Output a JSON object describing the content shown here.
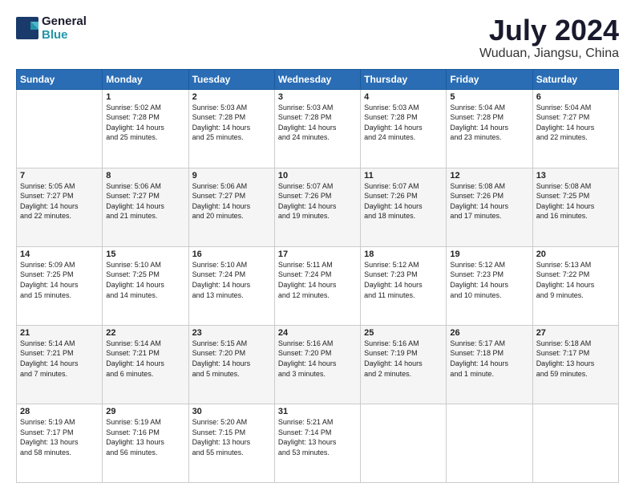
{
  "header": {
    "logo_line1": "General",
    "logo_line2": "Blue",
    "title": "July 2024",
    "subtitle": "Wuduan, Jiangsu, China"
  },
  "weekdays": [
    "Sunday",
    "Monday",
    "Tuesday",
    "Wednesday",
    "Thursday",
    "Friday",
    "Saturday"
  ],
  "weeks": [
    [
      {
        "day": "",
        "info": ""
      },
      {
        "day": "1",
        "info": "Sunrise: 5:02 AM\nSunset: 7:28 PM\nDaylight: 14 hours\nand 25 minutes."
      },
      {
        "day": "2",
        "info": "Sunrise: 5:03 AM\nSunset: 7:28 PM\nDaylight: 14 hours\nand 25 minutes."
      },
      {
        "day": "3",
        "info": "Sunrise: 5:03 AM\nSunset: 7:28 PM\nDaylight: 14 hours\nand 24 minutes."
      },
      {
        "day": "4",
        "info": "Sunrise: 5:03 AM\nSunset: 7:28 PM\nDaylight: 14 hours\nand 24 minutes."
      },
      {
        "day": "5",
        "info": "Sunrise: 5:04 AM\nSunset: 7:28 PM\nDaylight: 14 hours\nand 23 minutes."
      },
      {
        "day": "6",
        "info": "Sunrise: 5:04 AM\nSunset: 7:27 PM\nDaylight: 14 hours\nand 22 minutes."
      }
    ],
    [
      {
        "day": "7",
        "info": "Sunrise: 5:05 AM\nSunset: 7:27 PM\nDaylight: 14 hours\nand 22 minutes."
      },
      {
        "day": "8",
        "info": "Sunrise: 5:06 AM\nSunset: 7:27 PM\nDaylight: 14 hours\nand 21 minutes."
      },
      {
        "day": "9",
        "info": "Sunrise: 5:06 AM\nSunset: 7:27 PM\nDaylight: 14 hours\nand 20 minutes."
      },
      {
        "day": "10",
        "info": "Sunrise: 5:07 AM\nSunset: 7:26 PM\nDaylight: 14 hours\nand 19 minutes."
      },
      {
        "day": "11",
        "info": "Sunrise: 5:07 AM\nSunset: 7:26 PM\nDaylight: 14 hours\nand 18 minutes."
      },
      {
        "day": "12",
        "info": "Sunrise: 5:08 AM\nSunset: 7:26 PM\nDaylight: 14 hours\nand 17 minutes."
      },
      {
        "day": "13",
        "info": "Sunrise: 5:08 AM\nSunset: 7:25 PM\nDaylight: 14 hours\nand 16 minutes."
      }
    ],
    [
      {
        "day": "14",
        "info": "Sunrise: 5:09 AM\nSunset: 7:25 PM\nDaylight: 14 hours\nand 15 minutes."
      },
      {
        "day": "15",
        "info": "Sunrise: 5:10 AM\nSunset: 7:25 PM\nDaylight: 14 hours\nand 14 minutes."
      },
      {
        "day": "16",
        "info": "Sunrise: 5:10 AM\nSunset: 7:24 PM\nDaylight: 14 hours\nand 13 minutes."
      },
      {
        "day": "17",
        "info": "Sunrise: 5:11 AM\nSunset: 7:24 PM\nDaylight: 14 hours\nand 12 minutes."
      },
      {
        "day": "18",
        "info": "Sunrise: 5:12 AM\nSunset: 7:23 PM\nDaylight: 14 hours\nand 11 minutes."
      },
      {
        "day": "19",
        "info": "Sunrise: 5:12 AM\nSunset: 7:23 PM\nDaylight: 14 hours\nand 10 minutes."
      },
      {
        "day": "20",
        "info": "Sunrise: 5:13 AM\nSunset: 7:22 PM\nDaylight: 14 hours\nand 9 minutes."
      }
    ],
    [
      {
        "day": "21",
        "info": "Sunrise: 5:14 AM\nSunset: 7:21 PM\nDaylight: 14 hours\nand 7 minutes."
      },
      {
        "day": "22",
        "info": "Sunrise: 5:14 AM\nSunset: 7:21 PM\nDaylight: 14 hours\nand 6 minutes."
      },
      {
        "day": "23",
        "info": "Sunrise: 5:15 AM\nSunset: 7:20 PM\nDaylight: 14 hours\nand 5 minutes."
      },
      {
        "day": "24",
        "info": "Sunrise: 5:16 AM\nSunset: 7:20 PM\nDaylight: 14 hours\nand 3 minutes."
      },
      {
        "day": "25",
        "info": "Sunrise: 5:16 AM\nSunset: 7:19 PM\nDaylight: 14 hours\nand 2 minutes."
      },
      {
        "day": "26",
        "info": "Sunrise: 5:17 AM\nSunset: 7:18 PM\nDaylight: 14 hours\nand 1 minute."
      },
      {
        "day": "27",
        "info": "Sunrise: 5:18 AM\nSunset: 7:17 PM\nDaylight: 13 hours\nand 59 minutes."
      }
    ],
    [
      {
        "day": "28",
        "info": "Sunrise: 5:19 AM\nSunset: 7:17 PM\nDaylight: 13 hours\nand 58 minutes."
      },
      {
        "day": "29",
        "info": "Sunrise: 5:19 AM\nSunset: 7:16 PM\nDaylight: 13 hours\nand 56 minutes."
      },
      {
        "day": "30",
        "info": "Sunrise: 5:20 AM\nSunset: 7:15 PM\nDaylight: 13 hours\nand 55 minutes."
      },
      {
        "day": "31",
        "info": "Sunrise: 5:21 AM\nSunset: 7:14 PM\nDaylight: 13 hours\nand 53 minutes."
      },
      {
        "day": "",
        "info": ""
      },
      {
        "day": "",
        "info": ""
      },
      {
        "day": "",
        "info": ""
      }
    ]
  ]
}
